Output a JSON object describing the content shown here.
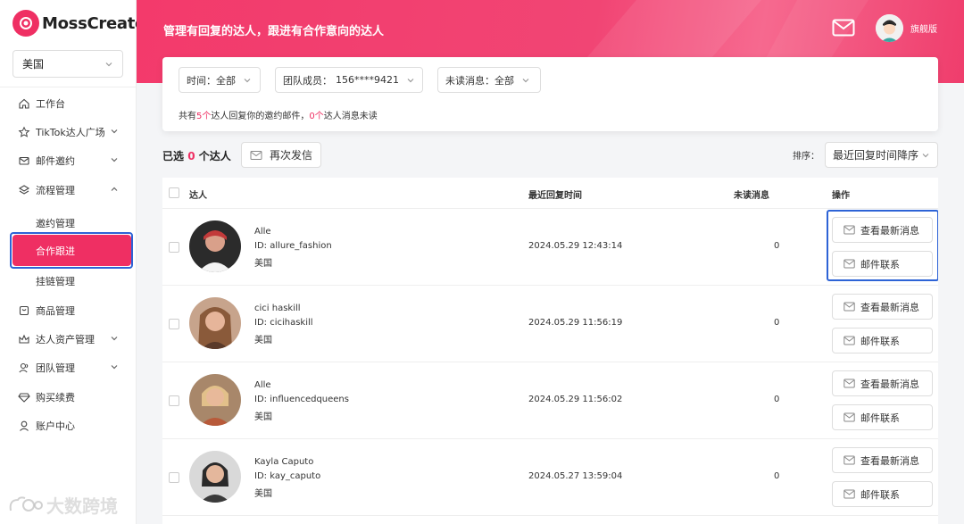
{
  "app": {
    "logo_text": "MossCreator",
    "region": "美国"
  },
  "sidebar": {
    "items": [
      {
        "label": "工作台",
        "icon": "home-icon"
      },
      {
        "label": "TikTok达人广场",
        "icon": "star-icon"
      },
      {
        "label": "邮件邀约",
        "icon": "mail-icon"
      },
      {
        "label": "流程管理",
        "icon": "flow-icon"
      },
      {
        "label": "商品管理",
        "icon": "product-icon"
      },
      {
        "label": "达人资产管理",
        "icon": "crown-icon"
      },
      {
        "label": "团队管理",
        "icon": "team-icon"
      },
      {
        "label": "购买续费",
        "icon": "diamond-icon"
      },
      {
        "label": "账户中心",
        "icon": "user-icon"
      }
    ],
    "sub_items": [
      "邀约管理",
      "合作跟进",
      "挂链管理"
    ],
    "active_sub": "合作跟进"
  },
  "header": {
    "title": "管理有回复的达人，跟进有合作意向的达人",
    "plan": "旗舰版"
  },
  "filters": {
    "time": "时间：全部",
    "member_label": "团队成员：",
    "member_value": "156****9421",
    "unread": "未读消息：全部"
  },
  "summary": {
    "prefix": "共有",
    "count_replied": "5个",
    "middle": "达人回复你的邀约邮件，",
    "count_unread": "0个",
    "suffix": "达人消息未读"
  },
  "toolbar": {
    "selected_prefix": "已选",
    "selected_count": "0",
    "selected_suffix": "个达人",
    "resend": "再次发信",
    "sort_label": "排序：",
    "sort_value": "最近回复时间降序"
  },
  "table": {
    "columns": [
      "达人",
      "最近回复时间",
      "未读消息",
      "操作"
    ],
    "rows": [
      {
        "name": "Alle",
        "id": "ID: allure_fashion",
        "region": "美国",
        "time": "2024.05.29 12:43:14",
        "unread": "0"
      },
      {
        "name": "cici haskill",
        "id": "ID: cicihaskill",
        "region": "美国",
        "time": "2024.05.29 11:56:19",
        "unread": "0"
      },
      {
        "name": "Alle",
        "id": "ID: influencedqueens",
        "region": "美国",
        "time": "2024.05.29 11:56:02",
        "unread": "0"
      },
      {
        "name": "Kayla Caputo",
        "id": "ID: kay_caputo",
        "region": "美国",
        "time": "2024.05.27 13:59:04",
        "unread": "0"
      }
    ],
    "action_view": "查看最新消息",
    "action_mail": "邮件联系"
  },
  "watermark": "大数跨境",
  "colors": {
    "accent": "#ef2f63",
    "highlight": "#2d63d6"
  }
}
